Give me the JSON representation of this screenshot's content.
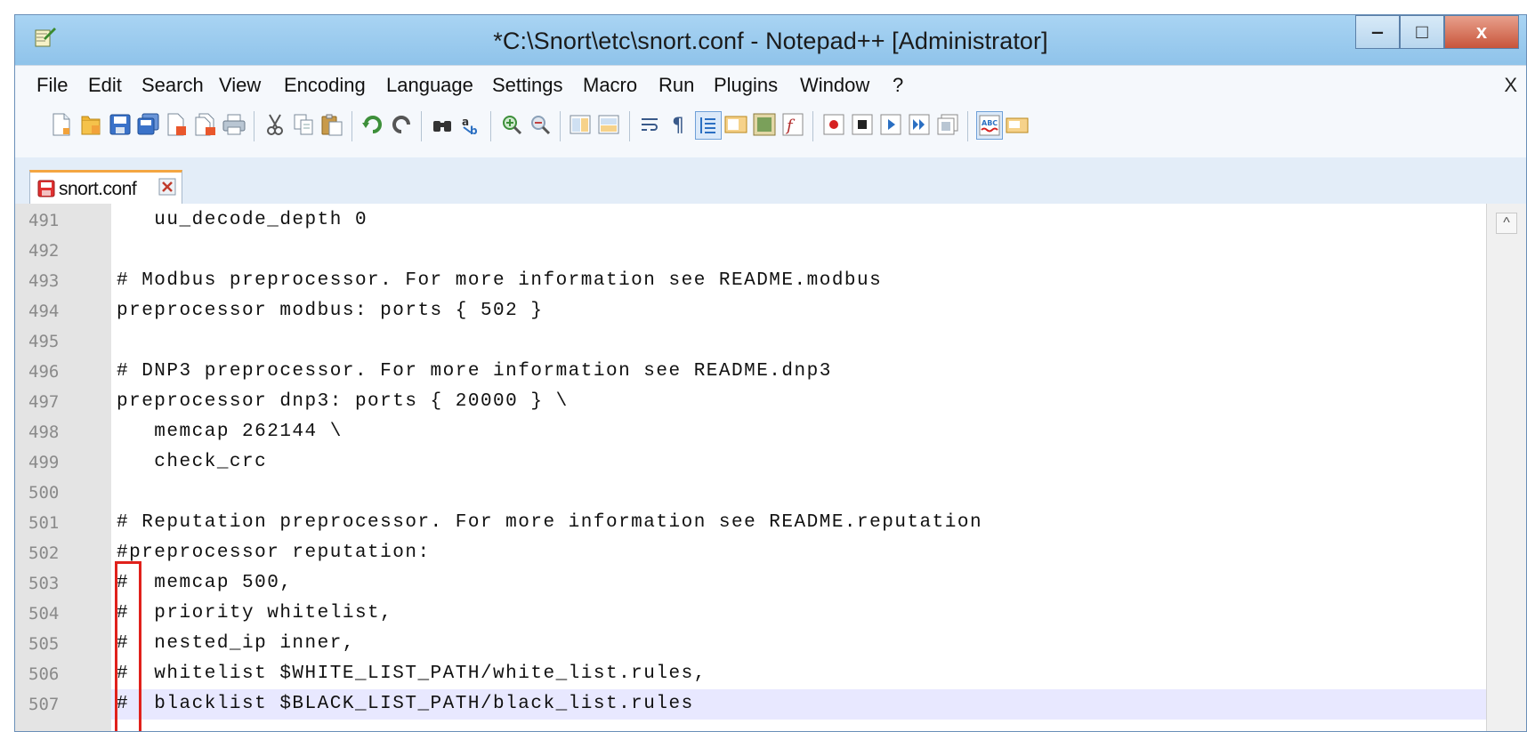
{
  "window": {
    "title": "*C:\\Snort\\etc\\snort.conf - Notepad++ [Administrator]",
    "minimize_glyph": "‒",
    "maximize_glyph": "□",
    "close_glyph": "x"
  },
  "menu": {
    "items": [
      "File",
      "Edit",
      "Search",
      "View",
      "Encoding",
      "Language",
      "Settings",
      "Macro",
      "Run",
      "Plugins",
      "Window",
      "?"
    ],
    "close_glyph": "X"
  },
  "toolbar": {
    "icons": [
      "new-file-icon",
      "open-file-icon",
      "save-icon",
      "save-all-icon",
      "close-icon",
      "close-all-icon",
      "print-icon",
      "cut-icon",
      "copy-icon",
      "paste-icon",
      "undo-icon",
      "redo-icon",
      "find-icon",
      "replace-icon",
      "zoom-in-icon",
      "zoom-out-icon",
      "sync-vertical-icon",
      "sync-horizontal-icon",
      "word-wrap-icon",
      "show-all-characters-icon",
      "indent-guide-icon",
      "user-language-icon",
      "document-map-icon",
      "function-list-icon",
      "record-macro-icon",
      "stop-recording-icon",
      "play-macro-icon",
      "run-macro-multiple-icon",
      "save-macro-icon",
      "spell-check-icon",
      "change-text-icon"
    ]
  },
  "tab": {
    "label": "snort.conf",
    "icon": "unsaved-file-icon"
  },
  "editor": {
    "lines": [
      {
        "num": "491",
        "text": "   uu_decode_depth 0"
      },
      {
        "num": "492",
        "text": ""
      },
      {
        "num": "493",
        "text": "# Modbus preprocessor. For more information see README.modbus"
      },
      {
        "num": "494",
        "text": "preprocessor modbus: ports { 502 }"
      },
      {
        "num": "495",
        "text": ""
      },
      {
        "num": "496",
        "text": "# DNP3 preprocessor. For more information see README.dnp3"
      },
      {
        "num": "497",
        "text": "preprocessor dnp3: ports { 20000 } \\"
      },
      {
        "num": "498",
        "text": "   memcap 262144 \\"
      },
      {
        "num": "499",
        "text": "   check_crc"
      },
      {
        "num": "500",
        "text": ""
      },
      {
        "num": "501",
        "text": "# Reputation preprocessor. For more information see README.reputation"
      },
      {
        "num": "502",
        "text": "#preprocessor reputation:"
      },
      {
        "num": "503",
        "text": "#  memcap 500,"
      },
      {
        "num": "504",
        "text": "#  priority whitelist,"
      },
      {
        "num": "505",
        "text": "#  nested_ip inner,"
      },
      {
        "num": "506",
        "text": "#  whitelist $WHITE_LIST_PATH/white_list.rules,"
      },
      {
        "num": "507",
        "text": "#  blacklist $BLACK_LIST_PATH/black_list.rules",
        "current": true
      }
    ],
    "scroll_up_glyph": "^"
  },
  "colors": {
    "titlebar": "#9fcdf0",
    "close_button": "#c8553b",
    "highlight_box": "#e0211b",
    "current_line": "#e8e8ff",
    "tab_accent": "#f4a642"
  }
}
